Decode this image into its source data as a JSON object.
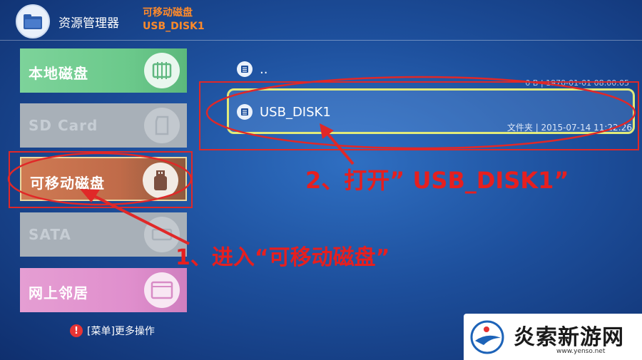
{
  "header": {
    "app_title": "资源管理器",
    "path_title": "可移动磁盘",
    "path_sub": "USB_DISK1"
  },
  "sidebar": {
    "drives": [
      {
        "label": "本地磁盘",
        "icon": "memory-chip-icon"
      },
      {
        "label": "SD Card",
        "icon": "sd-card-icon"
      },
      {
        "label": "可移动磁盘",
        "icon": "usb-drive-icon"
      },
      {
        "label": "SATA",
        "icon": "sata-drive-icon"
      },
      {
        "label": "网上邻居",
        "icon": "network-window-icon"
      }
    ],
    "menu_hint": "[菜单]更多操作"
  },
  "files": [
    {
      "name": "..",
      "meta": "0 B | 1970-01-01 08:00:05"
    },
    {
      "name": "USB_DISK1",
      "meta": "文件夹 | 2015-07-14 11:22:26"
    }
  ],
  "annotations": {
    "step1": "1、进入“可移动磁盘”",
    "step2": "2、打开”  USB_DISK1”"
  },
  "watermark": {
    "text": "炎索新游网",
    "url": "www.yenso.net"
  },
  "colors": {
    "background": "#1d4f9c",
    "accent_orange": "#ff8a2a",
    "annotation_red": "#e61f1f",
    "selected_border": "#e1ea7a"
  }
}
